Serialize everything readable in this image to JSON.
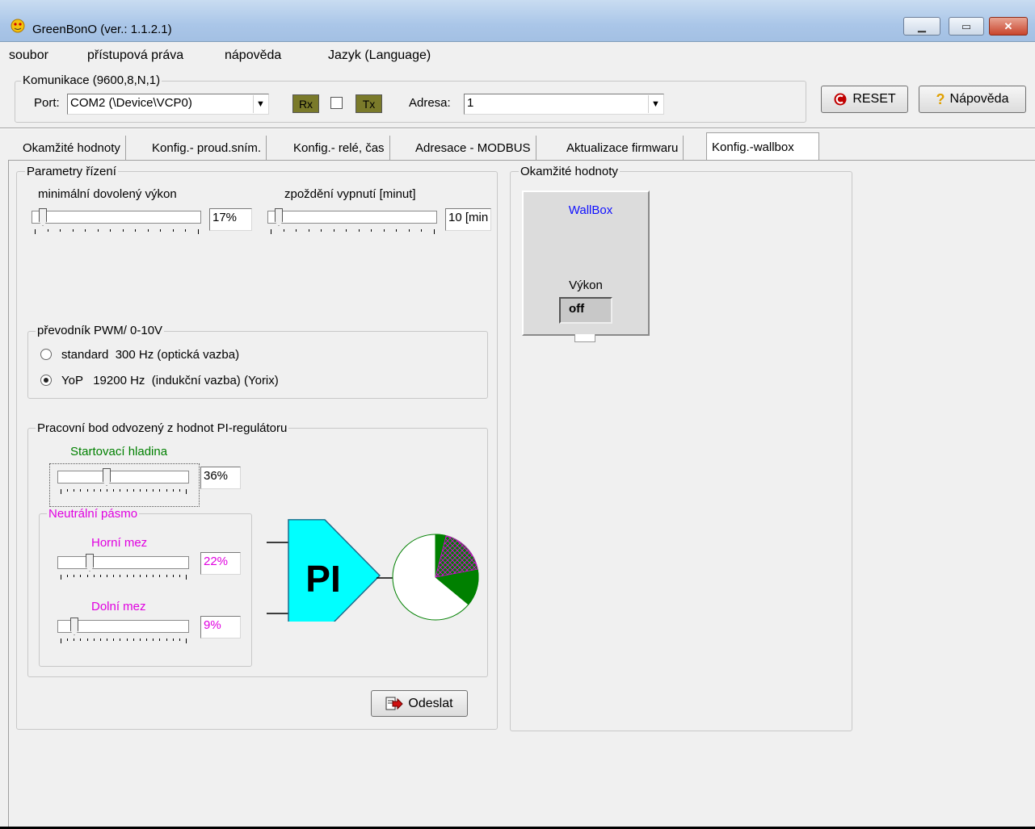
{
  "window": {
    "title": "GreenBonO (ver.: 1.1.2.1)"
  },
  "menu": [
    "soubor",
    "přístupová práva",
    "nápověda",
    "Jazyk (Language)"
  ],
  "comm": {
    "legend": "Komunikace (9600,8,N,1)",
    "port_label": "Port:",
    "port_value": "COM2 (\\Device\\VCP0)",
    "rx_label": "Rx",
    "tx_label": "Tx",
    "address_label": "Adresa:",
    "address_value": "1"
  },
  "toolbar": {
    "reset_label": "RESET",
    "help_label": "Nápověda"
  },
  "tabs": [
    "Okamžité hodnoty",
    "Konfig.- proud.sním.",
    "Konfig.- relé, čas",
    "Adresace - MODBUS",
    "Aktualizace firmwaru",
    "Konfig.-wallbox"
  ],
  "params": {
    "legend": "Parametry řízení",
    "min_power_label": "minimální dovolený výkon",
    "min_power_value": "17%",
    "min_power_level": 0.03,
    "delay_label": "zpoždění vypnutí [minut]",
    "delay_value": "10 [min",
    "delay_level": 0.03
  },
  "pwm": {
    "legend": "převodník PWM/ 0-10V",
    "options": [
      "standard  300 Hz (optická vazba)",
      "YoP   19200 Hz  (indukční vazba) (Yorix)"
    ],
    "selected_index": 1
  },
  "pi": {
    "legend": "Pracovní bod odvozený z hodnot PI-regulátoru",
    "start_label": "Startovací hladina",
    "start_value": "36%",
    "start_level": 0.36,
    "neutral_legend": "Neutrální pásmo",
    "upper_label": "Horní mez",
    "upper_value": "22%",
    "upper_level": 0.22,
    "lower_label": "Dolní mez",
    "lower_value": "9%",
    "lower_level": 0.09,
    "block_label": "PI",
    "colors": {
      "pi_block": "#00ffff",
      "pie_fill": "#008000",
      "hatch": "#e000e0"
    }
  },
  "send_label": "Odeslat",
  "live": {
    "legend": "Okamžité hodnoty",
    "wallbox_label": "WallBox",
    "power_label": "Výkon",
    "power_value": "off"
  }
}
